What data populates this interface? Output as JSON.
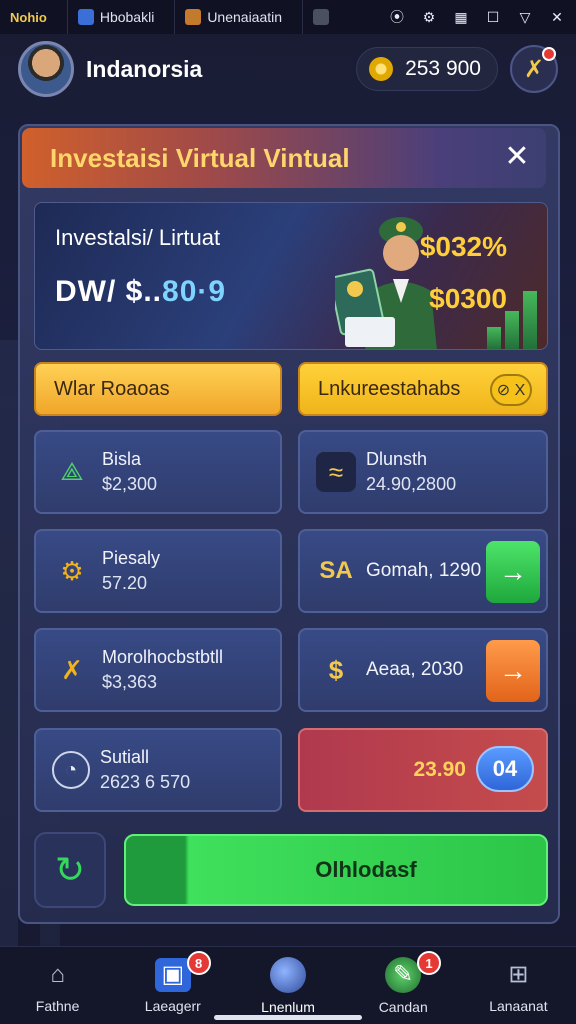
{
  "statusbar": {
    "app": "Nohio",
    "tab1": "Hbobakli",
    "tab2": "Unenaiaatin"
  },
  "header": {
    "username": "Indanorsia",
    "coins": "253 900"
  },
  "panel": {
    "title": "Investaisi Virtual Vintual",
    "banner": {
      "title": "Investalsi/ Lirtuat",
      "balance_prefix": "DW/ $..",
      "balance_accent": "80·9",
      "value1": "$032%",
      "value2": "$0300"
    },
    "tabs": {
      "left": "Wlar Roaoas",
      "right": "Lnkureestahabs",
      "right_badge": "⊘ X"
    },
    "cards": [
      {
        "name": "Bisla",
        "value": "$2,300"
      },
      {
        "name": "Dlunsth",
        "value": "24.90,2800"
      },
      {
        "name": "Piesaly",
        "value": "57.20"
      },
      {
        "label": "Gomah, 1290",
        "icon_text": "SA"
      },
      {
        "name": "Morolhocbstbtll",
        "value": "$3,363"
      },
      {
        "label": "Aeaa, 2030",
        "icon_text": "$"
      },
      {
        "name": "Sutiall",
        "value": "2623 6 570"
      },
      {
        "label": "23.90",
        "pill": "04"
      }
    ],
    "primary_button": "Olhlodasf"
  },
  "bottom_nav": [
    {
      "label": "Fathne",
      "icon": "home-icon"
    },
    {
      "label": "Laeagerr",
      "icon": "package-icon",
      "badge": "8"
    },
    {
      "label": "Lnenlum",
      "icon": "globe-icon"
    },
    {
      "label": "Candan",
      "icon": "compass-icon",
      "badge": "1"
    },
    {
      "label": "Lanaanat",
      "icon": "grid-icon"
    }
  ],
  "colors": {
    "accent_gold": "#ffcf3a",
    "accent_green": "#2cc548",
    "badge_red": "#e53935"
  }
}
